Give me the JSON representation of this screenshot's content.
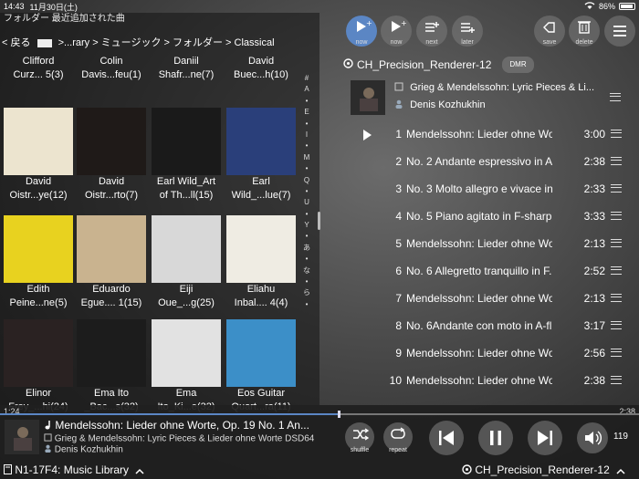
{
  "status": {
    "time": "14:43",
    "date": "11月30日(土)",
    "battery": "86%"
  },
  "library": {
    "title": "フォルダー 最近追加された曲",
    "back": "< 戻る",
    "path": ">...rary > ミュージック > フォルダー > Classical"
  },
  "index_letters": [
    "#",
    "A",
    "•",
    "E",
    "•",
    "I",
    "•",
    "M",
    "•",
    "Q",
    "•",
    "U",
    "•",
    "Y",
    "•",
    "あ",
    "•",
    "な",
    "•",
    "ら",
    "•"
  ],
  "albums": [
    {
      "l1": "Clifford",
      "l2": "Curz... 5(3)"
    },
    {
      "l1": "Colin",
      "l2": "Davis...feu(1)"
    },
    {
      "l1": "Daniil",
      "l2": "Shafr...ne(7)"
    },
    {
      "l1": "David",
      "l2": "Buec...h(10)"
    },
    {
      "l1": "David",
      "l2": "Oistr...ye(12)"
    },
    {
      "l1": "David",
      "l2": "Oistr...rto(7)"
    },
    {
      "l1": "Earl Wild_Art",
      "l2": "of Th...ll(15)"
    },
    {
      "l1": "Earl",
      "l2": "Wild_...lue(7)"
    },
    {
      "l1": "Edith",
      "l2": "Peine...ne(5)"
    },
    {
      "l1": "Eduardo",
      "l2": "Egue.... 1(15)"
    },
    {
      "l1": "Eiji",
      "l2": "Oue_...g(25)"
    },
    {
      "l1": "Eliahu",
      "l2": "Inbal.... 4(4)"
    },
    {
      "l1": "Elinor",
      "l2": "Frey_...hi(24)"
    },
    {
      "l1": "Ema Ito",
      "l2": "_Bac...s(32)"
    },
    {
      "l1": "Ema",
      "l2": "Ito_Ki...e(32)"
    },
    {
      "l1": "Eos Guitar",
      "l2": "Quart...ra(11)"
    }
  ],
  "cover_colors": [
    "#3b3b3b",
    "#2f2f2f",
    "#c9a24a",
    "#e7d7b0",
    "#ece4cf",
    "#1f1a18",
    "#1a1a1a",
    "#2a3f7a",
    "#e8d21f",
    "#c9b38f",
    "#d8d8d8",
    "#efece3",
    "#2a2222",
    "#1c1c1c",
    "#e2e2e2",
    "#3c8fc8"
  ],
  "toolbar": {
    "buttons": [
      {
        "label": "now",
        "icon": "play-now-icon"
      },
      {
        "label": "now",
        "icon": "play-now-icon"
      },
      {
        "label": "next",
        "icon": "add-next-icon"
      },
      {
        "label": "later",
        "icon": "add-later-icon"
      },
      {
        "label": "save",
        "icon": "save-icon"
      },
      {
        "label": "delete",
        "icon": "trash-icon"
      }
    ]
  },
  "renderer": {
    "name": "CH_Precision_Renderer-12",
    "badge": "DMR"
  },
  "album_info": {
    "title": "Grieg & Mendelssohn: Lyric Pieces & Li...",
    "artist": "Denis Kozhukhin"
  },
  "tracks": [
    {
      "no": "1",
      "title": "Mendelssohn: Lieder ohne Wo...",
      "dur": "3:00",
      "playing": true
    },
    {
      "no": "2",
      "title": "No. 2 Andante espressivo in A...",
      "dur": "2:38"
    },
    {
      "no": "3",
      "title": "No. 3 Molto allegro e vivace in...",
      "dur": "2:33"
    },
    {
      "no": "4",
      "title": "No. 5 Piano agitato in F-sharp...",
      "dur": "3:33"
    },
    {
      "no": "5",
      "title": "Mendelssohn: Lieder ohne Wo...",
      "dur": "2:13"
    },
    {
      "no": "6",
      "title": "No. 6 Allegretto tranquillo in F...",
      "dur": "2:52"
    },
    {
      "no": "7",
      "title": "Mendelssohn: Lieder ohne Wo...",
      "dur": "2:13"
    },
    {
      "no": "8",
      "title": "No. 6Andante con moto in A-fl...",
      "dur": "3:17"
    },
    {
      "no": "9",
      "title": "Mendelssohn: Lieder ohne Wo...",
      "dur": "2:56"
    },
    {
      "no": "10",
      "title": "Mendelssohn: Lieder ohne Wo...",
      "dur": "2:38"
    }
  ],
  "player": {
    "elapsed": "1:24",
    "total": "2:38",
    "progress": 0.53,
    "title": "Mendelssohn: Lieder ohne Worte, Op. 19 No. 1 An...",
    "album": "Grieg & Mendelssohn: Lyric Pieces & Lieder ohne Worte DSD64",
    "artist": "Denis Kozhukhin",
    "shuffle": "shuffle",
    "repeat": "repeat",
    "volume": "119"
  },
  "footer": {
    "server": "N1-17F4: Music Library",
    "renderer": "CH_Precision_Renderer-12"
  },
  "accent": "#5b86c4"
}
